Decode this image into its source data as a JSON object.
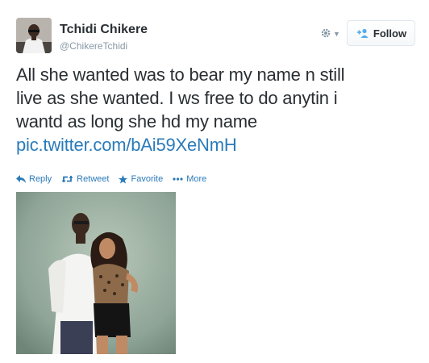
{
  "tweet": {
    "author": {
      "fullname": "Tchidi Chikere",
      "username": "@ChikereTchidi",
      "avatar_icon": "user-avatar"
    },
    "header": {
      "settings_icon": "gear-icon",
      "follow_label": "Follow",
      "follow_icon": "add-user-icon"
    },
    "text_lines": [
      "All she wanted was to bear my name n still",
      "live as she wanted. I ws free to do anytin i",
      "wantd as long she hd my name"
    ],
    "link": "pic.twitter.com/bAi59XeNmH",
    "actions": {
      "reply": "Reply",
      "retweet": "Retweet",
      "favorite": "Favorite",
      "more": "More"
    },
    "media": {
      "description_icon": "tweet-photo"
    },
    "colors": {
      "link": "#2b7bb9",
      "text": "#292f33",
      "muted": "#8899a6",
      "follow_icon": "#55acee"
    }
  }
}
